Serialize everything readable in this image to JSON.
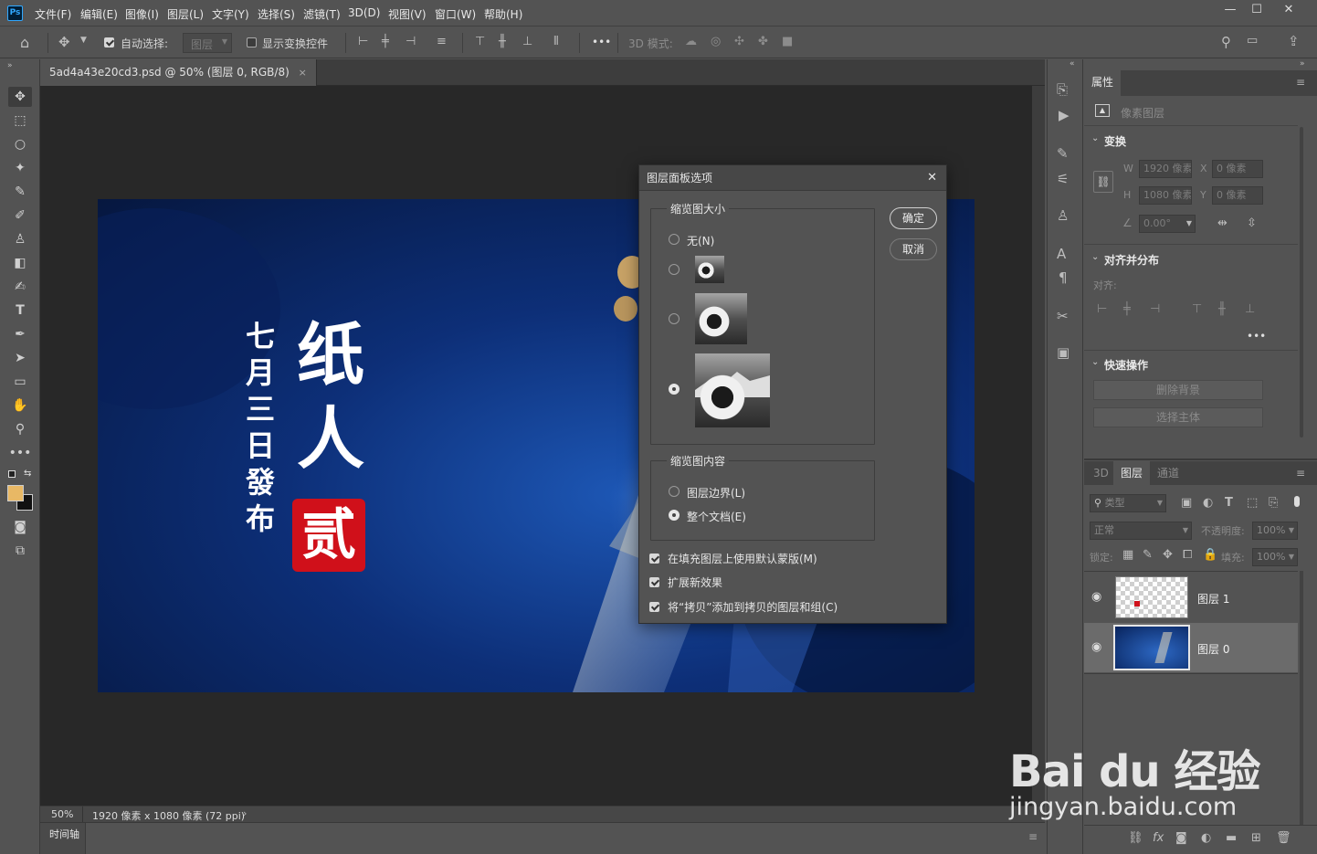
{
  "app": {
    "logo": "Ps"
  },
  "menu": [
    "文件(F)",
    "编辑(E)",
    "图像(I)",
    "图层(L)",
    "文字(Y)",
    "选择(S)",
    "滤镜(T)",
    "3D(D)",
    "视图(V)",
    "窗口(W)",
    "帮助(H)"
  ],
  "window_controls": {
    "minimize": "—",
    "maximize": "☐",
    "close": "✕"
  },
  "options_bar": {
    "auto_select_label": "自动选择:",
    "auto_select_checked": true,
    "auto_select_target": "图层",
    "show_transform_label": "显示变换控件",
    "show_transform_checked": false,
    "more": "•••",
    "mode_3d_label": "3D 模式:"
  },
  "document": {
    "tab_title": "5ad4a43e20cd3.psd @ 50% (图层 0, RGB/8)",
    "tab_close": "×",
    "artwork": {
      "vertical_text": [
        "七",
        "月",
        "三",
        "日",
        "發",
        "布"
      ],
      "title_chars": [
        "纸",
        "人"
      ],
      "seal_char": "贰"
    }
  },
  "status": {
    "zoom": "50%",
    "info": "1920 像素 x 1080 像素 (72 ppi)",
    "arrow": "›"
  },
  "timeline": {
    "label": "时间轴"
  },
  "dialog": {
    "title": "图层面板选项",
    "close": "✕",
    "thumb_size_group": "缩览图大小",
    "thumb_none_label": "无(N)",
    "thumb_selected_index": 3,
    "thumb_content_group": "缩览图内容",
    "content_options": [
      {
        "label": "图层边界(L)",
        "checked": false
      },
      {
        "label": "整个文档(E)",
        "checked": true
      }
    ],
    "checkboxes": [
      {
        "label": "在填充图层上使用默认蒙版(M)",
        "checked": true
      },
      {
        "label": "扩展新效果",
        "checked": true
      },
      {
        "label": "将“拷贝”添加到拷贝的图层和组(C)",
        "checked": true
      }
    ],
    "ok": "确定",
    "cancel": "取消"
  },
  "properties": {
    "tab": "属性",
    "layer_type": "像素图层",
    "transform_title": "变换",
    "w_label": "W",
    "w_value": "1920 像素",
    "h_label": "H",
    "h_value": "1080 像素",
    "x_label": "X",
    "x_value": "0 像素",
    "y_label": "Y",
    "y_value": "0 像素",
    "angle_value": "0.00°",
    "align_title": "对齐并分布",
    "align_label": "对齐:",
    "quick_title": "快速操作",
    "remove_bg": "删除背景",
    "select_subject": "选择主体",
    "more": "•••"
  },
  "layers_panel": {
    "tabs": [
      "3D",
      "图层",
      "通道"
    ],
    "active_tab": "图层",
    "filter_label": "类型",
    "blend_mode": "正常",
    "opacity_label": "不透明度:",
    "opacity_value": "100%",
    "lock_label": "锁定:",
    "fill_label": "填充:",
    "fill_value": "100%",
    "layers": [
      {
        "name": "图层 1",
        "visible": true,
        "selected": false
      },
      {
        "name": "图层 0",
        "visible": true,
        "selected": true
      }
    ]
  },
  "watermark": {
    "brand": "Bai du 经验",
    "url": "jingyan.baidu.com"
  },
  "colors": {
    "panel": "#535353",
    "canvas": "#282828",
    "accent": "#31a8ff",
    "seal": "#d0101a",
    "foreground": "#e8b865"
  }
}
